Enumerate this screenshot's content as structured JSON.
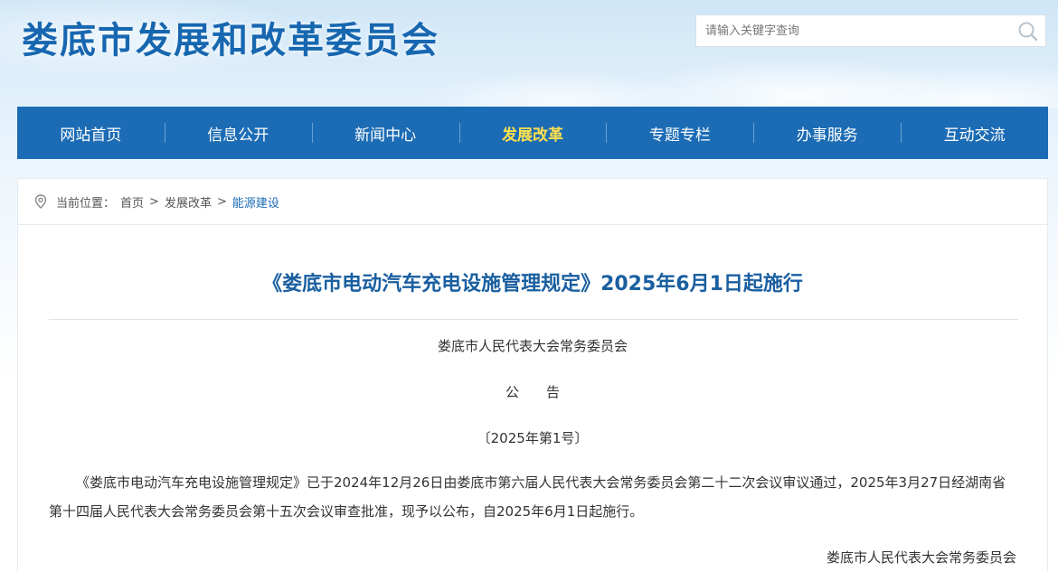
{
  "header": {
    "site_title": "娄底市发展和改革委员会",
    "search_placeholder": "请输入关键字查询",
    "search_value": ""
  },
  "nav": {
    "items": [
      {
        "label": "网站首页",
        "active": false
      },
      {
        "label": "信息公开",
        "active": false
      },
      {
        "label": "新闻中心",
        "active": false
      },
      {
        "label": "发展改革",
        "active": true
      },
      {
        "label": "专题专栏",
        "active": false
      },
      {
        "label": "办事服务",
        "active": false
      },
      {
        "label": "互动交流",
        "active": false
      }
    ]
  },
  "breadcrumb": {
    "prefix": "当前位置：",
    "items": [
      "首页",
      "发展改革",
      "能源建设"
    ],
    "separator": ">"
  },
  "article": {
    "title": "《娄底市电动汽车充电设施管理规定》2025年6月1日起施行",
    "issuer": "娄底市人民代表大会常务委员会",
    "notice_label": "公　　告",
    "notice_number": "〔2025年第1号〕",
    "body": "《娄底市电动汽车充电设施管理规定》已于2024年12月26日由娄底市第六届人民代表大会常务委员会第二十二次会议审议通过，2025年3月27日经湖南省第十四届人民代表大会常务委员会第十五次会议审查批准，现予以公布，自2025年6月1日起施行。",
    "signature": "娄底市人民代表大会常务委员会"
  },
  "colors": {
    "brand_blue": "#1c6cb5",
    "title_blue": "#1767b0",
    "active_nav": "#ffe14d"
  },
  "icons": {
    "search": "search-icon",
    "location": "location-pin-icon"
  }
}
